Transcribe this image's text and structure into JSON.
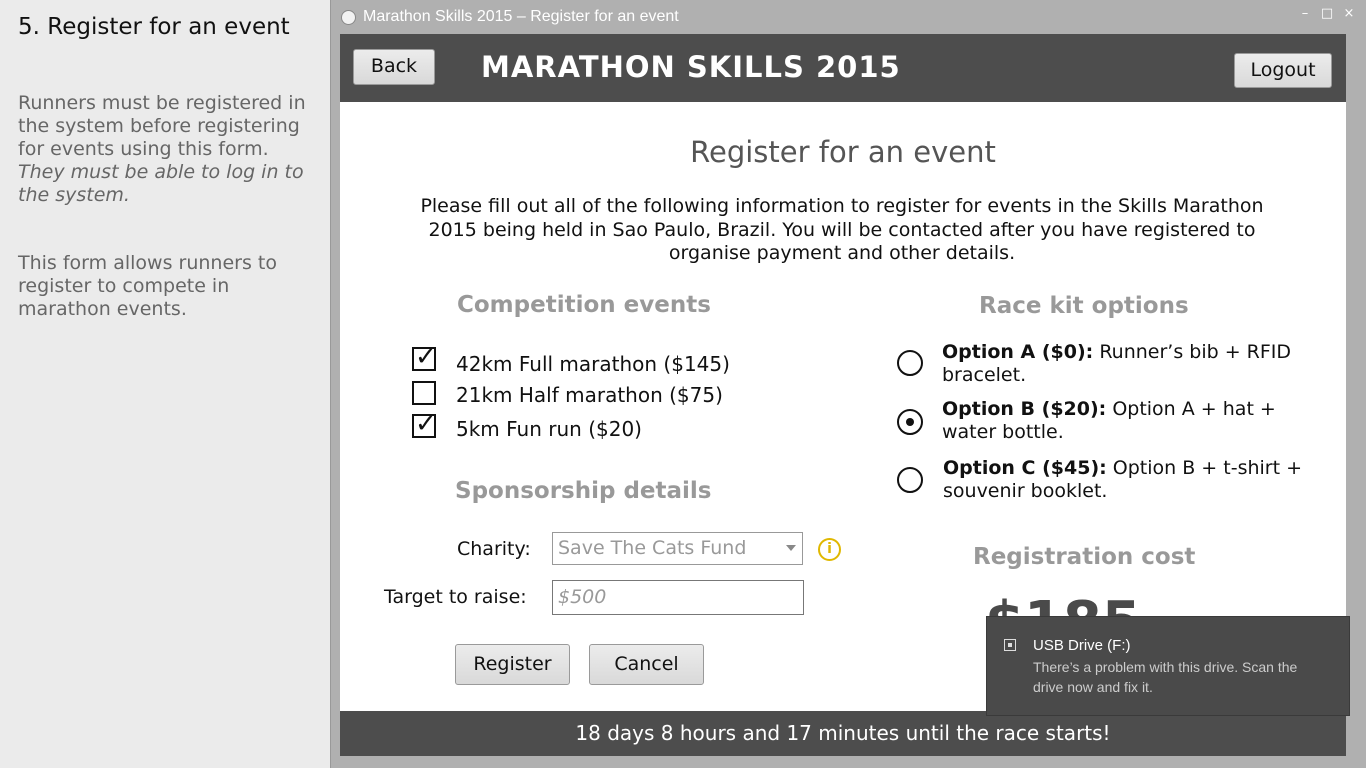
{
  "instructions": {
    "title": "5. Register for an event",
    "para1_normal": "Runners must be registered in the system before registering for events using this form.",
    "para1_italic": "They must be able to log in to the system.",
    "para2": "This form allows runners to register to compete in marathon events."
  },
  "window": {
    "title": "Marathon Skills 2015 – Register for an event",
    "controls": {
      "minimize": "–",
      "maximize": "□",
      "close": "×"
    }
  },
  "header": {
    "back_label": "Back",
    "app_title": "MARATHON SKILLS 2015",
    "logout_label": "Logout"
  },
  "page": {
    "heading": "Register for an event",
    "intro": "Please fill out all of the following information to register for events in the Skills Marathon 2015 being held in Sao Paulo, Brazil. You will be contacted after you have registered to organise payment and other details."
  },
  "events": {
    "title": "Competition events",
    "items": [
      {
        "label": "42km Full marathon ($145)",
        "checked": true
      },
      {
        "label": "21km Half marathon ($75)",
        "checked": false
      },
      {
        "label": "5km Fun run ($20)",
        "checked": true
      }
    ]
  },
  "race_kit": {
    "title": "Race kit options",
    "options": [
      {
        "name": "Option A ($0):",
        "desc": "Runner’s bib + RFID bracelet.",
        "selected": false
      },
      {
        "name": "Option B ($20):",
        "desc": "Option A + hat + water bottle.",
        "selected": true
      },
      {
        "name": "Option C ($45):",
        "desc": "Option B + t-shirt + souvenir booklet.",
        "selected": false
      }
    ]
  },
  "sponsorship": {
    "title": "Sponsorship details",
    "charity_label": "Charity:",
    "charity_value": "Save The Cats Fund",
    "target_label": "Target to raise:",
    "target_placeholder": "$500"
  },
  "actions": {
    "register_label": "Register",
    "cancel_label": "Cancel"
  },
  "cost": {
    "title": "Registration cost",
    "value": "$185"
  },
  "footer": {
    "countdown": "18 days 8 hours and 17 minutes until the race starts!"
  },
  "toast": {
    "title": "USB Drive (F:)",
    "body": "There’s a problem with this drive.  Scan the drive now and fix it."
  }
}
